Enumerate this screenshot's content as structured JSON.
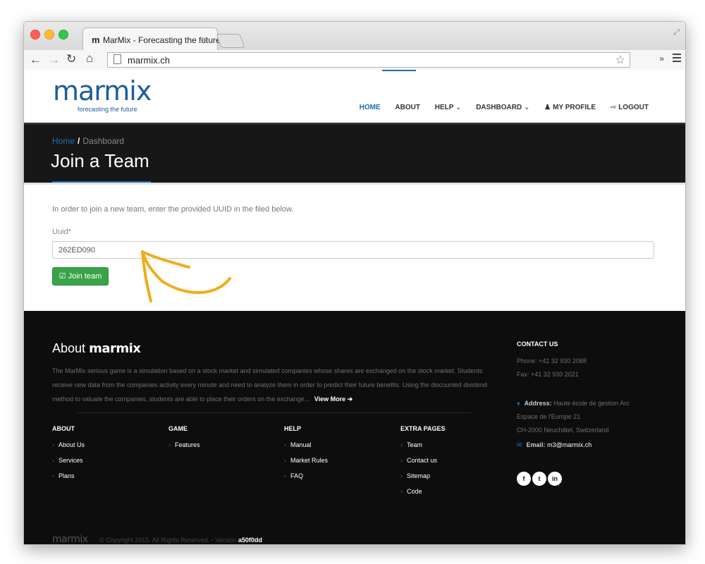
{
  "browser": {
    "tab_favicon": "m",
    "tab_title": "MarMix - Forecasting the future",
    "tab_close": "×",
    "url": "marmix.ch",
    "icons": {
      "back": "back-arrow-icon",
      "forward": "forward-arrow-icon",
      "reload": "reload-icon",
      "home": "home-icon",
      "star": "star-icon",
      "menu": "menu-icon"
    }
  },
  "header": {
    "logo_word": "marmix",
    "logo_tagline": "forecasting the future",
    "nav": {
      "home": "HOME",
      "about": "ABOUT",
      "help": "HELP",
      "dashboard": "DASHBOARD",
      "profile": "MY PROFILE",
      "logout": "LOGOUT"
    }
  },
  "band": {
    "breadcrumb_home": "Home",
    "breadcrumb_sep": "/",
    "breadcrumb_current": "Dashboard",
    "title": "Join a Team"
  },
  "form": {
    "intro": "In order to join a new team, enter the provided UUID in the filed below.",
    "label": "Uuid*",
    "value": "262ED090",
    "button": "Join team"
  },
  "footer": {
    "about_prefix": "About",
    "about_brand": "marmix",
    "about_text": "The MarMix serious game is a simulation based on a stock market and simulated companies whose shares are exchanged on the stock market. Students receive new data from the companies activity every minute and need to analyze them in order to predict their future benefits. Using the discounted dividend method to valuate the companies, students are able to place their orders on the exchange...",
    "view_more": "View More",
    "columns": {
      "about": {
        "head": "ABOUT",
        "links": [
          "About Us",
          "Services",
          "Plans"
        ]
      },
      "game": {
        "head": "GAME",
        "links": [
          "Features"
        ]
      },
      "help": {
        "head": "HELP",
        "links": [
          "Manual",
          "Market Rules",
          "FAQ"
        ]
      },
      "extra": {
        "head": "EXTRA PAGES",
        "links": [
          "Team",
          "Contact us",
          "Sitemap",
          "Code"
        ]
      }
    },
    "contact": {
      "head": "CONTACT US",
      "phone": "Phone: +41 32 930 2088",
      "fax": "Fax: +41 32 930 2021",
      "address_label": "Address:",
      "address_1": "Haute école de gestion Arc",
      "address_2": "Espace de l'Europe 21",
      "address_3": "CH-2000 Neuchâtel, Switzerland",
      "email_label": "Email:",
      "email": "m3@marmix.ch"
    },
    "social": {
      "facebook": "f",
      "twitter": "t",
      "linkedin": "in"
    },
    "copyright_logo": "marmix",
    "copyright": "© Copyright 2015. All Rights Reserved. - Version",
    "version": "a50f0dd"
  },
  "colors": {
    "accent": "#1a6fb3",
    "success": "#3aa34a",
    "annotation": "#f0ad1b",
    "dark": "#0d0d0d"
  }
}
